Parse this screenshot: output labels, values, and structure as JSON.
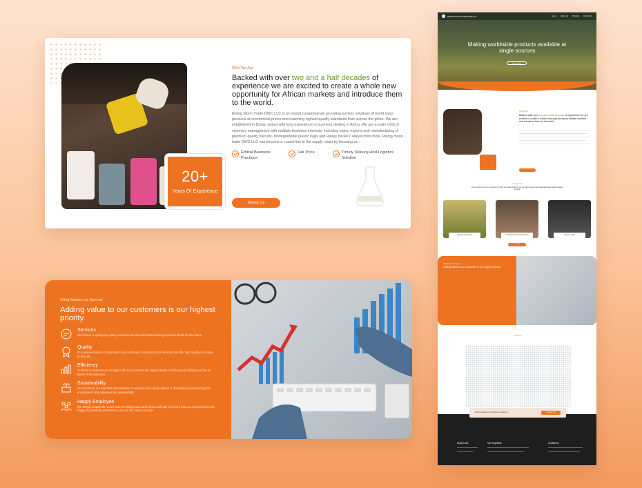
{
  "about": {
    "eyebrow": "Who We Are",
    "headline_pre": "Backed with over ",
    "headline_highlight": "two and a half decades",
    "headline_post": " of experience we are excited to create a whole new opportunity for African markets and introduce them to the world.",
    "paragraph": "Rising Moon Trade DWC LLC is an export conglomerate providing turnkey solutions of world class products at economical prices and matching highest quality standards from across the globe. We are established in Dubai, based with long experience in business dealing in Africa. We are a brain child of visionary management with multiple business interests, including sales, exports and manufacturing of premium quality biscuits, biodegradable plastic bags and Raney Nickel Catalyst from India. Rising moon trade DWC LLC has become a crucial link in the supply chain by focusing on :",
    "badge_number": "20+",
    "badge_label": "Years Of Experience",
    "checks": [
      "Ethical Business Practices",
      "Fair Price",
      "Timely Delivery And Logistics Solution"
    ],
    "button": "About Us"
  },
  "special": {
    "eyebrow": "What Makes Us Special",
    "title": "Adding value to our customers is our highest priority.",
    "items": [
      {
        "name": "Services",
        "desc": "We believe in giving top quality customer service that fosters strong business bonds for the future.",
        "icon": "chat-icon"
      },
      {
        "name": "Quality",
        "desc": "Our primary motive is to introduce our customers to products and services that offer high quality and value to their life",
        "icon": "quality-badge-icon"
      },
      {
        "name": "Efficiency",
        "desc": "To thrive in business we recognize the need to show the highest levels of efficiency at all times and at all levels of the business",
        "icon": "growth-chart-icon"
      },
      {
        "name": "Sustainability",
        "desc": "Our business, our activities and provision of services has a large impact in developing and protecting the environment and resources for sustainability",
        "icon": "plant-icon"
      },
      {
        "name": "Happy Employee",
        "desc": "We deeply respect the entire team of Rising Moon and strive each day to ensure that our employees remain happy for, positivity and intimes, you are the fuel to success",
        "icon": "team-icon"
      }
    ]
  },
  "fullpage": {
    "brand": "RISING MOON TRADE DWC LLC",
    "nav": [
      "Home",
      "About Us",
      "Products",
      "Contact Us"
    ],
    "hero_title": "Making worldwide products available at single sources",
    "hero_button": "Explore More",
    "segments_eyebrow": "Our Segments",
    "segments_title": "Our strength lies in our commitment to bring innovative products into the market backed with sustainable and reliable logistics network",
    "segments": [
      "Agricultural Solutions",
      "Industrial & Chemicals Solutions",
      "Catalysts & Dye"
    ],
    "view_all": "View All",
    "locate_title": "Locate Us",
    "cta_text": "Got Any Questions ? Feel Free to contact us",
    "cta_button": "Contact Us",
    "footer_cols": [
      "Quick Links",
      "Our Segments",
      "Contact Us"
    ]
  },
  "colors": {
    "accent": "#ee7321",
    "highlight": "#6a9a2e"
  }
}
